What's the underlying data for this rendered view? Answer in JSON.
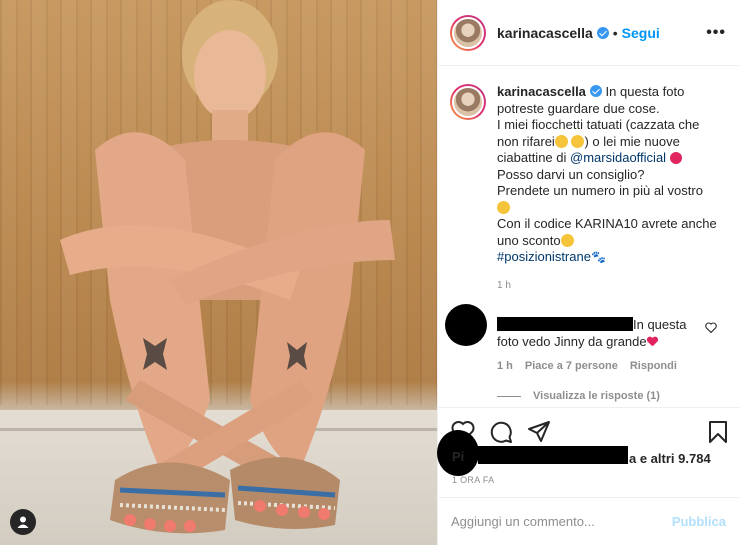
{
  "header": {
    "username": "karinacascella",
    "separator": "•",
    "follow_label": "Segui",
    "more_label": "•••"
  },
  "caption": {
    "username": "karinacascella",
    "line1": "In questa foto",
    "line2": "potreste guardare due cose.",
    "line3": "I miei fiocchetti tatuati (cazzata che",
    "line4a": "non rifarei",
    "line4b": ") o lei mie nuove",
    "line5a": "ciabattine di",
    "mention": "@marsidaofficial",
    "line6": "Posso darvi un consiglio?",
    "line7": "Prendete un numero in più al vostro",
    "line8": "Con il codice KARINA10 avrete anche",
    "line9": "uno sconto",
    "hashtag": "#posizionistrane",
    "time": "1 h"
  },
  "comment": {
    "text_a": "In questa",
    "text_b": "foto vedo Jinny da grande",
    "time": "1 h",
    "likes": "Piace a 7 persone",
    "reply": "Rispondi",
    "view_replies": "Visualizza le risposte (1)"
  },
  "likes": {
    "prefix": "Pi",
    "suffix": "a e altri 9.784",
    "time": "1 ORA FA"
  },
  "add_comment": {
    "placeholder": "Aggiungi un commento...",
    "publish_label": "Pubblica"
  },
  "colors": {
    "accent": "#0095f6",
    "verified": "#3897f0",
    "heart": "#e0245e"
  }
}
